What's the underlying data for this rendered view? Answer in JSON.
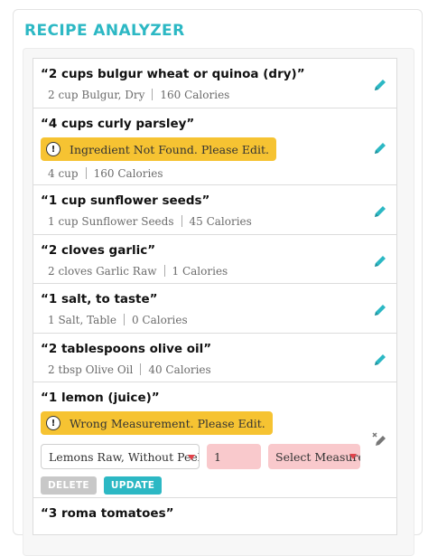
{
  "app": {
    "title": "RECIPE ANALYZER"
  },
  "colors": {
    "accent": "#2cb8c4",
    "warning": "#f6c332",
    "error_fill": "#f9c9cc",
    "caret": "#e2424a"
  },
  "ingredients": [
    {
      "title": "“2 cups bulgur wheat or quinoa (dry)”",
      "measure": "2 cup Bulgur, Dry",
      "calories": "160 Calories",
      "icon": "pencil-icon"
    },
    {
      "title": "“4 cups curly parsley”",
      "warning": "Ingredient Not Found. Please Edit.",
      "measure": "4 cup",
      "calories": "160 Calories",
      "icon": "pencil-icon"
    },
    {
      "title": "“1 cup sunflower seeds”",
      "measure": "1 cup Sunflower Seeds",
      "calories": "45 Calories",
      "icon": "pencil-icon"
    },
    {
      "title": "“2 cloves garlic”",
      "measure": "2 cloves Garlic Raw",
      "calories": "1 Calories",
      "icon": "pencil-icon"
    },
    {
      "title": "“1 salt, to taste”",
      "measure": "1 Salt, Table",
      "calories": "0 Calories",
      "icon": "pencil-icon"
    },
    {
      "title": "“2 tablespoons olive oil”",
      "measure": "2 tbsp Olive Oil",
      "calories": "40 Calories",
      "icon": "pencil-icon"
    },
    {
      "title": "“1 lemon (juice)”",
      "warning": "Wrong Measurement. Please Edit.",
      "edit": {
        "food_value": "Lemons Raw, Without Peel",
        "quantity_value": "1",
        "unit_placeholder": "Select Measure",
        "delete_label": "DELETE",
        "update_label": "UPDATE"
      },
      "icon": "pencil-x-icon"
    },
    {
      "title": "“3 roma tomatoes”"
    }
  ]
}
